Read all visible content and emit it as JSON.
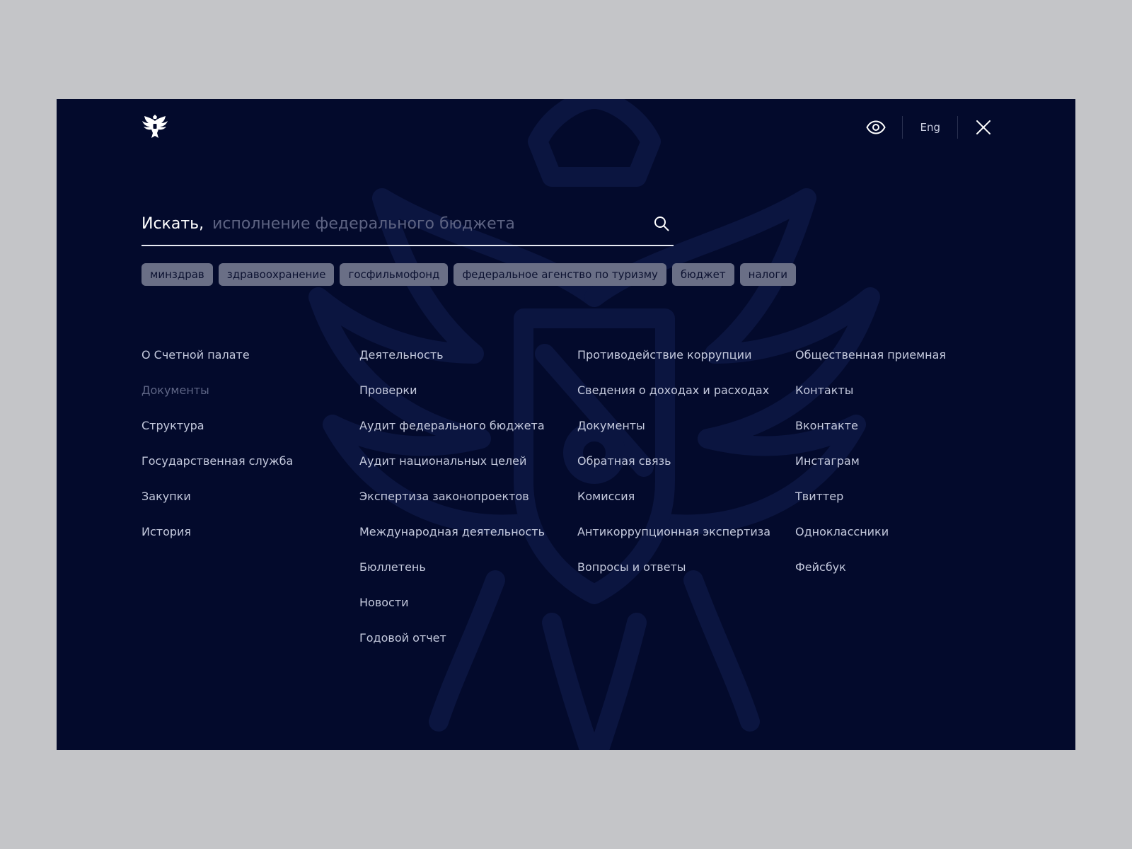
{
  "header": {
    "logo_icon": "double-headed-eagle-emblem-icon",
    "accessibility_icon": "eye-icon",
    "lang_label": "Eng",
    "close_icon": "close-icon"
  },
  "search": {
    "label": "Искать,",
    "placeholder": "исполнение федерального бюджета",
    "icon": "search-icon"
  },
  "tags": [
    "минздрав",
    "здравоохранение",
    "госфильмофонд",
    "федеральное агенство по туризму",
    "бюджет",
    "налоги"
  ],
  "columns": [
    {
      "items": [
        {
          "label": "О Счетной палате"
        },
        {
          "label": "Документы",
          "muted": true
        },
        {
          "label": "Структура"
        },
        {
          "label": "Государственная служба"
        },
        {
          "label": "Закупки"
        },
        {
          "label": "История"
        }
      ]
    },
    {
      "items": [
        {
          "label": "Деятельность"
        },
        {
          "label": "Проверки"
        },
        {
          "label": "Аудит федерального бюджета"
        },
        {
          "label": "Аудит национальных целей"
        },
        {
          "label": "Экспертиза законопроектов"
        },
        {
          "label": "Международная деятельность"
        },
        {
          "label": "Бюллетень"
        },
        {
          "label": "Новости"
        },
        {
          "label": "Годовой отчет"
        }
      ]
    },
    {
      "items": [
        {
          "label": "Противодействие коррупции"
        },
        {
          "label": "Сведения о доходах и расходах"
        },
        {
          "label": "Документы"
        },
        {
          "label": "Обратная связь"
        },
        {
          "label": "Комиссия"
        },
        {
          "label": "Антикоррупционная экспертиза"
        },
        {
          "label": "Вопросы и ответы"
        }
      ]
    },
    {
      "items": [
        {
          "label": "Общественная приемная"
        },
        {
          "label": "Контакты"
        },
        {
          "label": "Вконтакте"
        },
        {
          "label": "Инстаграм"
        },
        {
          "label": "Твиттер"
        },
        {
          "label": "Одноклассники"
        },
        {
          "label": "Фейсбук"
        }
      ]
    }
  ],
  "colors": {
    "background": "#030a2c",
    "page": "#c4c5c8",
    "tag_bg": "#6a6f86",
    "link": "#c4c9dd",
    "link_muted": "#5f6686"
  }
}
